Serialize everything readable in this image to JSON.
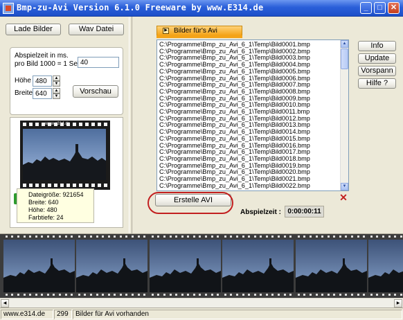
{
  "window": {
    "title": "Bmp-zu-Avi  Version 6.1.0    Freeware  by  www.E314.de",
    "minimize": "_",
    "maximize": "□",
    "close": "✕"
  },
  "left": {
    "load_images_button": "Lade Bilder",
    "wav_button": "Wav Datei",
    "settings": {
      "duration_label_1": "Abspielzeit in ms.",
      "duration_label_2": "pro Bild  1000 = 1 Sec.",
      "duration_value": "40",
      "height_label": "Höhe",
      "height_value": "480",
      "width_label": "Breite",
      "width_value": "640",
      "preview_button": "Vorschau"
    },
    "film_caption": "www.e314.de",
    "file_info": [
      "Dateigröße: 921654",
      "Breite: 640",
      "Höhe: 480",
      "Farbtiefe: 24"
    ]
  },
  "right": {
    "tab_label": "Bilder für's Avi",
    "files": [
      "C:\\Programme\\Bmp_zu_Avi_6_1\\Temp\\Bild0001.bmp",
      "C:\\Programme\\Bmp_zu_Avi_6_1\\Temp\\Bild0002.bmp",
      "C:\\Programme\\Bmp_zu_Avi_6_1\\Temp\\Bild0003.bmp",
      "C:\\Programme\\Bmp_zu_Avi_6_1\\Temp\\Bild0004.bmp",
      "C:\\Programme\\Bmp_zu_Avi_6_1\\Temp\\Bild0005.bmp",
      "C:\\Programme\\Bmp_zu_Avi_6_1\\Temp\\Bild0006.bmp",
      "C:\\Programme\\Bmp_zu_Avi_6_1\\Temp\\Bild0007.bmp",
      "C:\\Programme\\Bmp_zu_Avi_6_1\\Temp\\Bild0008.bmp",
      "C:\\Programme\\Bmp_zu_Avi_6_1\\Temp\\Bild0009.bmp",
      "C:\\Programme\\Bmp_zu_Avi_6_1\\Temp\\Bild0010.bmp",
      "C:\\Programme\\Bmp_zu_Avi_6_1\\Temp\\Bild0011.bmp",
      "C:\\Programme\\Bmp_zu_Avi_6_1\\Temp\\Bild0012.bmp",
      "C:\\Programme\\Bmp_zu_Avi_6_1\\Temp\\Bild0013.bmp",
      "C:\\Programme\\Bmp_zu_Avi_6_1\\Temp\\Bild0014.bmp",
      "C:\\Programme\\Bmp_zu_Avi_6_1\\Temp\\Bild0015.bmp",
      "C:\\Programme\\Bmp_zu_Avi_6_1\\Temp\\Bild0016.bmp",
      "C:\\Programme\\Bmp_zu_Avi_6_1\\Temp\\Bild0017.bmp",
      "C:\\Programme\\Bmp_zu_Avi_6_1\\Temp\\Bild0018.bmp",
      "C:\\Programme\\Bmp_zu_Avi_6_1\\Temp\\Bild0019.bmp",
      "C:\\Programme\\Bmp_zu_Avi_6_1\\Temp\\Bild0020.bmp",
      "C:\\Programme\\Bmp_zu_Avi_6_1\\Temp\\Bild0021.bmp",
      "C:\\Programme\\Bmp_zu_Avi_6_1\\Temp\\Bild0022.bmp"
    ],
    "buttons": {
      "info": "Info",
      "update": "Update",
      "preview_play": "Vorspann",
      "help": "Hilfe ?"
    },
    "create_button": "Erstelle AVI",
    "duration_label": "Abspielzeit :",
    "duration_value": "0:00:00:11"
  },
  "status": {
    "site": "www.e314.de",
    "count": "299",
    "message": "Bilder für Avi vorhanden"
  },
  "colors": {
    "title_bar": "#2a5fd9",
    "tab_accent": "#f4a317",
    "highlight_ring": "#c21f1f",
    "info_bg": "#ffffe1"
  }
}
